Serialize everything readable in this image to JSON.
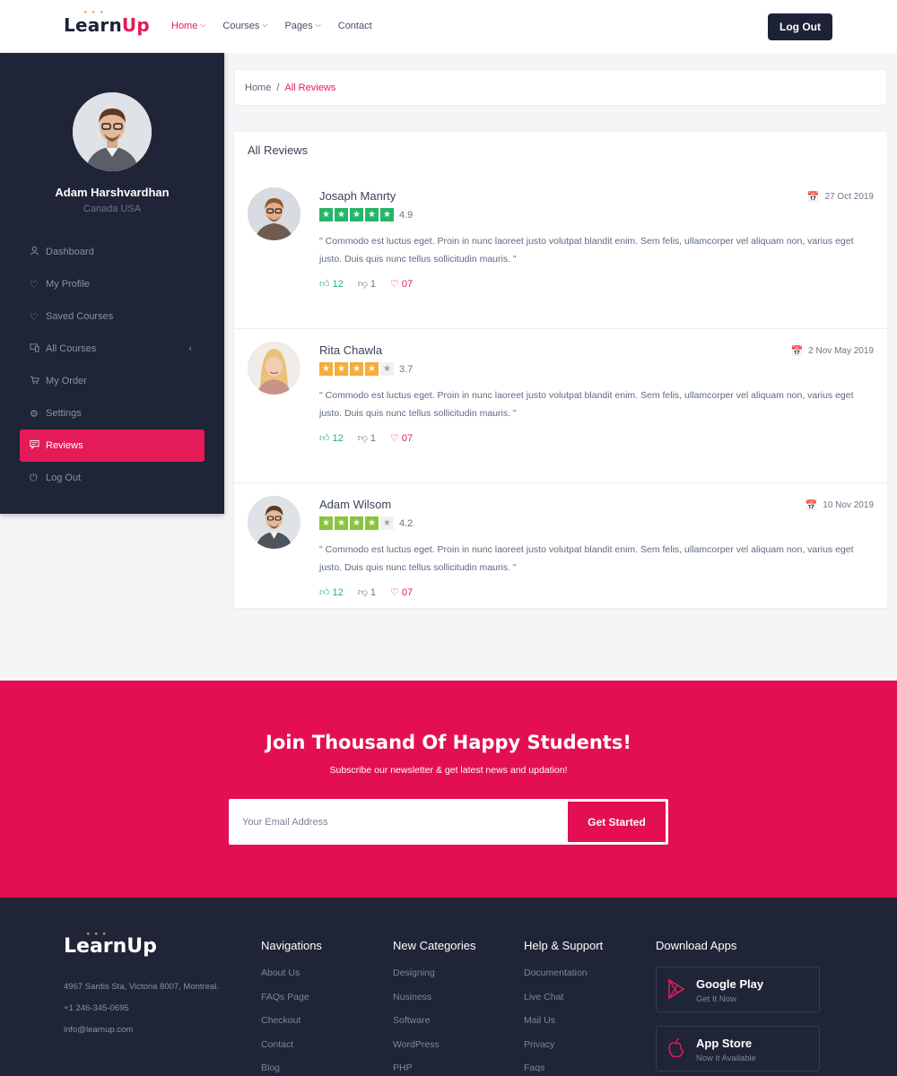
{
  "brand": {
    "logo_main": "Learn",
    "logo_accent": "Up"
  },
  "nav": {
    "items": [
      {
        "label": "Home",
        "active": true
      },
      {
        "label": "Courses",
        "active": false
      },
      {
        "label": "Pages",
        "active": false
      },
      {
        "label": "Contact",
        "active": false
      }
    ],
    "logout_label": "Log Out"
  },
  "sidebar": {
    "profile_name": "Adam Harshvardhan",
    "profile_location": "Canada USA",
    "items": [
      {
        "label": "Dashboard",
        "icon": "user-icon"
      },
      {
        "label": "My Profile",
        "icon": "heart-icon"
      },
      {
        "label": "Saved Courses",
        "icon": "heart-icon"
      },
      {
        "label": "All Courses",
        "icon": "laptop-icon"
      },
      {
        "label": "My Order",
        "icon": "cart-icon"
      },
      {
        "label": "Settings",
        "icon": "gear-icon"
      },
      {
        "label": "Reviews",
        "icon": "comment-icon"
      },
      {
        "label": "Log Out",
        "icon": "power-icon"
      }
    ],
    "active": "Reviews"
  },
  "breadcrumb": {
    "home": "Home",
    "separator": "/",
    "current": "All Reviews"
  },
  "reviews": {
    "title": "All Reviews",
    "items": [
      {
        "name": "Josaph Manrty",
        "date": "27 Oct 2019",
        "rating": "4.9",
        "stars_filled": 5,
        "star_color": "#27b56a",
        "text": "\" Commodo est luctus eget. Proin in nunc laoreet justo volutpat blandit enim. Sem felis, ullamcorper vel aliquam non, varius eget justo. Duis quis nunc tellus sollicitudin mauris. \"",
        "likes": "12",
        "dislikes": "1",
        "loves": "07"
      },
      {
        "name": "Rita Chawla",
        "date": "2 Nov May 2019",
        "rating": "3.7",
        "stars_filled": 4,
        "star_color": "#f7ad3b",
        "text": "\" Commodo est luctus eget. Proin in nunc laoreet justo volutpat blandit enim. Sem felis, ullamcorper vel aliquam non, varius eget justo. Duis quis nunc tellus sollicitudin mauris. \"",
        "likes": "12",
        "dislikes": "1",
        "loves": "07"
      },
      {
        "name": "Adam Wilsom",
        "date": "10 Nov 2019",
        "rating": "4.2",
        "stars_filled": 4,
        "star_color": "#8ac43f",
        "text": "\" Commodo est luctus eget. Proin in nunc laoreet justo volutpat blandit enim. Sem felis, ullamcorper vel aliquam non, varius eget justo. Duis quis nunc tellus sollicitudin mauris. \"",
        "likes": "12",
        "dislikes": "1",
        "loves": "07"
      }
    ]
  },
  "newsletter": {
    "title": "Join Thousand Of Happy Students!",
    "subtitle": "Subscribe our newsletter & get latest news and updation!",
    "placeholder": "Your Email Address",
    "button": "Get Started"
  },
  "footer": {
    "address": "4967 Sardis Sta, Victoria 8007, Montreal.",
    "phone": "+1 246-345-0695",
    "email": "info@learnup.com",
    "columns": [
      {
        "title": "Navigations",
        "links": [
          "About Us",
          "FAQs Page",
          "Checkout",
          "Contact",
          "Blog"
        ]
      },
      {
        "title": "New Categories",
        "links": [
          "Designing",
          "Nusiness",
          "Software",
          "WordPress",
          "PHP"
        ]
      },
      {
        "title": "Help & Support",
        "links": [
          "Documentation",
          "Live Chat",
          "Mail Us",
          "Privacy",
          "Faqs"
        ]
      }
    ],
    "apps_title": "Download Apps",
    "apps": [
      {
        "name": "Google Play",
        "sub": "Get It Now",
        "icon": "play-icon"
      },
      {
        "name": "App Store",
        "sub": "Now it Available",
        "icon": "apple-icon"
      }
    ]
  },
  "colors": {
    "accent": "#e41b58",
    "dark": "#1f2437",
    "newsletter_bg": "#e40f52"
  }
}
